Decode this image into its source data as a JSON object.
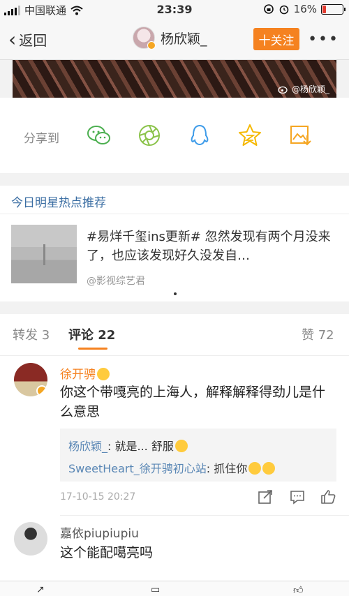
{
  "status_bar": {
    "carrier": "中国联通",
    "time": "23:39",
    "battery": "16%",
    "battery_level": 0.16
  },
  "nav": {
    "back_label": "返回",
    "title": "杨欣颖_",
    "follow_label": "十关注",
    "more_label": "•••"
  },
  "post_image": {
    "watermark": "@杨欣颖_"
  },
  "share": {
    "label": "分享到",
    "targets": [
      "wechat-icon",
      "moments-icon",
      "qq-icon",
      "qzone-icon",
      "save-image-icon"
    ]
  },
  "recommend": {
    "section_title": "今日明星热点推荐",
    "text": "#易烊千玺ins更新# 忽然发现有两个月没来了，也应该发现好久没发自…",
    "source": "@影视综艺君"
  },
  "tabs": {
    "repost": "转发 3",
    "comment": "评论 22",
    "like": "赞 72"
  },
  "comments": [
    {
      "user": "徐开骋",
      "text": "你这个带嘎亮的上海人，解释解释得劲儿是什么意思",
      "replies": [
        {
          "user": "杨欣颖_",
          "text": ": 就是... 舒服"
        },
        {
          "user": "SweetHeart_徐开骋初心站",
          "text": ": 抓住你"
        }
      ],
      "time": "17-10-15 20:27"
    },
    {
      "user": "嘉依piupiupiu",
      "text": "这个能配噶亮吗"
    }
  ],
  "colors": {
    "accent": "#f58220",
    "link": "#5a87b5",
    "section_title": "#3b6ea3"
  }
}
